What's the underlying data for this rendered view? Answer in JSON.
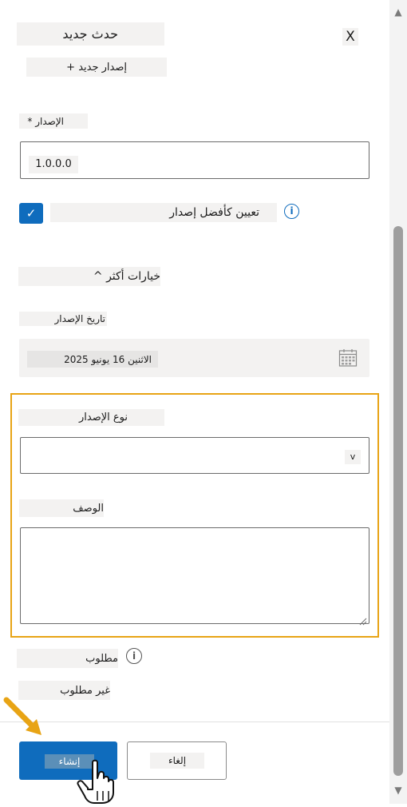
{
  "header": {
    "title": "حدث جديد",
    "close_label": "X",
    "new_version_button": "+ إصدار جديد"
  },
  "form": {
    "version_label": "* الإصدار",
    "version_value": "1.0.0.0",
    "set_best_version_label": "تعيين كأفضل إصدار",
    "checkbox_mark": "✓",
    "more_options_toggle": "^ خيارات أكثر",
    "release_date_label": "تاريخ الإصدار",
    "release_date_value": "الاثنين 16 يونيو 2025",
    "release_type_label": "نوع الإصدار",
    "release_type_value": "",
    "description_label": "الوصف",
    "description_value": "",
    "required_label": "مطلوب",
    "not_required_label": "غير مطلوب"
  },
  "footer": {
    "create_button": "إنشاء",
    "cancel_button": "إلغاء"
  },
  "colors": {
    "accent": "#0f6cbd",
    "highlight": "#e8a415",
    "chip": "#f3f2f1"
  }
}
